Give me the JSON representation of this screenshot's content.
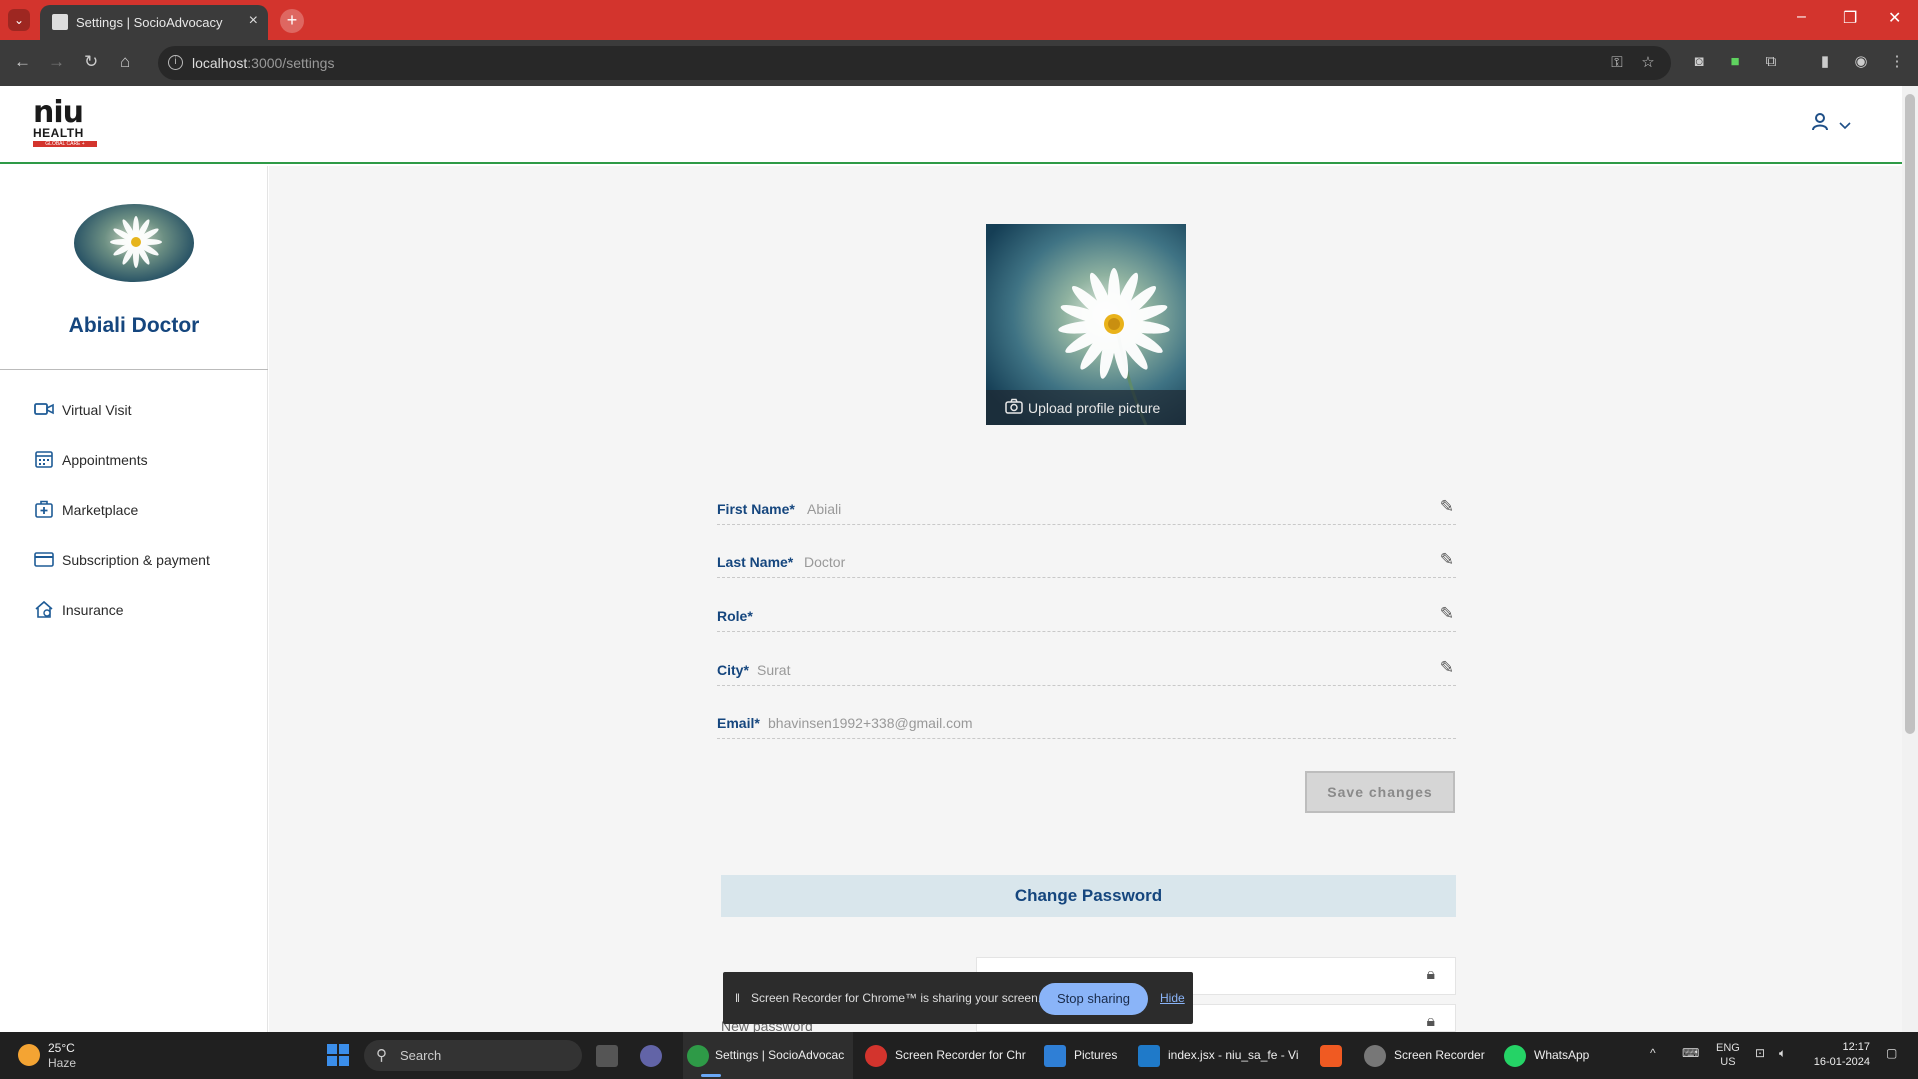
{
  "browser": {
    "tab_title": "Settings | SocioAdvocacy",
    "new_tab_symbol": "+",
    "url_host": "localhost",
    "url_path": ":3000/settings"
  },
  "app": {
    "logo_top": "niu",
    "logo_health": "HEALTH",
    "logo_tag": "GLOBAL CARE +"
  },
  "sidebar": {
    "user_name": "Abiali Doctor",
    "items": [
      {
        "label": "Virtual Visit",
        "icon": "video-camera-icon"
      },
      {
        "label": "Appointments",
        "icon": "calendar-icon"
      },
      {
        "label": "Marketplace",
        "icon": "medical-bag-icon"
      },
      {
        "label": "Subscription & payment",
        "icon": "credit-card-icon"
      },
      {
        "label": "Insurance",
        "icon": "home-shield-icon"
      }
    ]
  },
  "profile": {
    "upload_label": "Upload profile picture",
    "fields": {
      "first_name": {
        "label": "First Name*",
        "value": "Abiali"
      },
      "last_name": {
        "label": "Last Name*",
        "value": "Doctor"
      },
      "role": {
        "label": "Role*",
        "value": ""
      },
      "city": {
        "label": "City*",
        "value": "Surat"
      },
      "email": {
        "label": "Email*",
        "value": "bhavinsen1992+338@gmail.com"
      }
    },
    "save_label": "Save changes"
  },
  "password": {
    "heading": "Change Password",
    "new_password_label": "New password"
  },
  "recorder": {
    "message": "Screen Recorder for Chrome™ is sharing your screen.",
    "stop_label": "Stop sharing",
    "hide_label": "Hide"
  },
  "taskbar": {
    "temp": "25°C",
    "weather": "Haze",
    "search": "Search",
    "apps": [
      {
        "label": "Settings | SocioAdvocac"
      },
      {
        "label": "Screen Recorder for Chr"
      },
      {
        "label": "Pictures"
      },
      {
        "label": "index.jsx - niu_sa_fe - Vi"
      },
      {
        "label": "Screen Recorder"
      },
      {
        "label": "WhatsApp"
      }
    ],
    "lang_1": "ENG",
    "lang_2": "US",
    "time": "12:17",
    "date": "16-01-2024"
  },
  "colors": {
    "brand_blue": "#15467e",
    "brand_green": "#2e9a47",
    "browser_red": "#d3342d"
  }
}
